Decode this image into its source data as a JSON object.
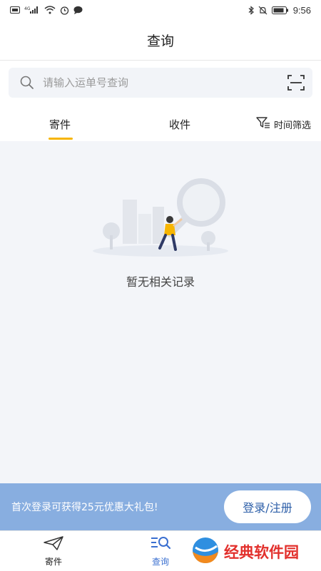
{
  "status_bar": {
    "time": "9:56",
    "network": "4G"
  },
  "header": {
    "title": "查询"
  },
  "search": {
    "placeholder": "请输入运单号查询"
  },
  "tabs": {
    "send": "寄件",
    "receive": "收件",
    "filter": "时间筛选",
    "active": "send",
    "indicator_color": "#F7B500"
  },
  "empty_state": {
    "text": "暂无相关记录"
  },
  "promo": {
    "text": "首次登录可获得25元优惠大礼包!",
    "button": "登录/注册",
    "background": "#88AEE0"
  },
  "bottom_nav": {
    "items": [
      {
        "label": "寄件",
        "icon": "paper-plane-icon"
      },
      {
        "label": "查询",
        "icon": "search-list-icon"
      }
    ],
    "active_color": "#3A6FD0"
  },
  "watermark": {
    "text": "经典软件园"
  }
}
